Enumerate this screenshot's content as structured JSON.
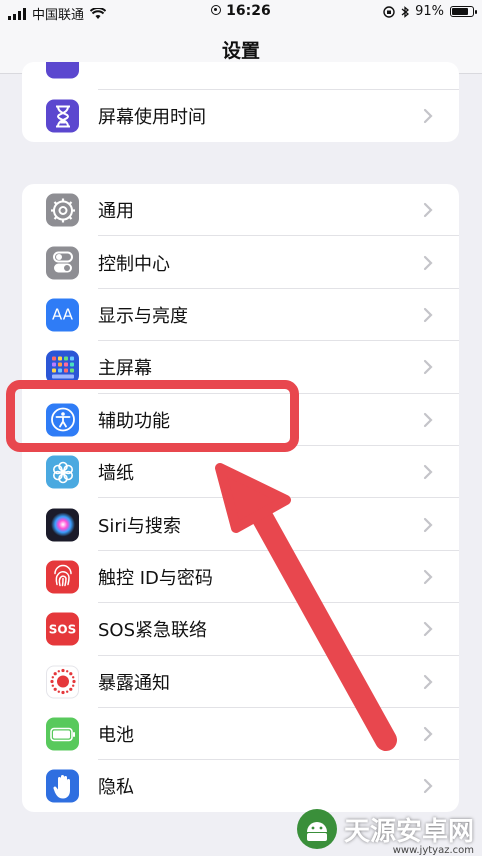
{
  "status_bar": {
    "carrier": "中国联通",
    "time": "16:26",
    "battery_pct": "91%",
    "battery_level": 0.91
  },
  "nav": {
    "title": "设置"
  },
  "top_group": {
    "items": [
      {
        "label": "屏幕使用时间",
        "icon": "hourglass-icon"
      }
    ]
  },
  "main_group": {
    "items": [
      {
        "label": "通用",
        "icon": "gear-icon"
      },
      {
        "label": "控制中心",
        "icon": "toggles-icon"
      },
      {
        "label": "显示与亮度",
        "icon": "text-size-icon",
        "glyph": "AA"
      },
      {
        "label": "主屏幕",
        "icon": "home-grid-icon"
      },
      {
        "label": "辅助功能",
        "icon": "accessibility-icon"
      },
      {
        "label": "墙纸",
        "icon": "flower-icon"
      },
      {
        "label": "Siri与搜索",
        "icon": "siri-icon"
      },
      {
        "label": "触控 ID与密码",
        "icon": "fingerprint-icon"
      },
      {
        "label": "SOS紧急联络",
        "icon": "sos-icon",
        "glyph": "SOS"
      },
      {
        "label": "暴露通知",
        "icon": "exposure-icon"
      },
      {
        "label": "电池",
        "icon": "battery-icon"
      },
      {
        "label": "隐私",
        "icon": "hand-icon"
      }
    ]
  },
  "watermark": {
    "text": "天源安卓网",
    "url": "www.jytyaz.com"
  },
  "colors": {
    "annotation_red": "#e8474e",
    "screen_time_purple": "#5b47cf",
    "gray_icon": "#8e8e93",
    "blue_icon": "#2f7cf6",
    "teal_icon": "#4aa9e0",
    "sos_red": "#e5383b",
    "green_icon": "#58c95c",
    "privacy_blue": "#2f6fe0"
  }
}
